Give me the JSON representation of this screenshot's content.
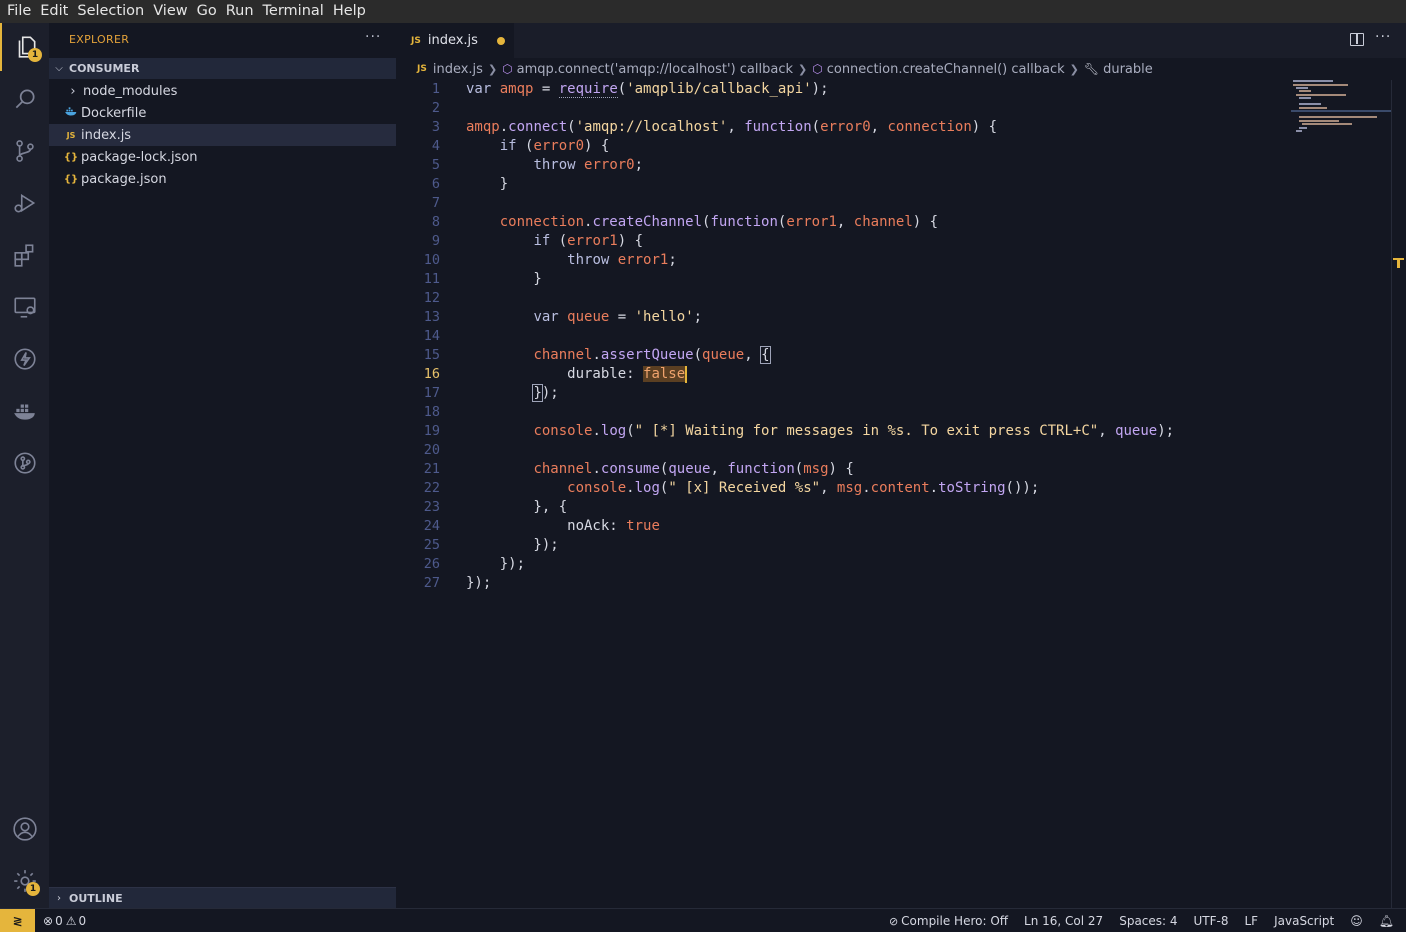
{
  "menu": [
    "File",
    "Edit",
    "Selection",
    "View",
    "Go",
    "Run",
    "Terminal",
    "Help"
  ],
  "activity": {
    "explorer_badge": "1",
    "settings_badge": "1"
  },
  "sidebar": {
    "title": "EXPLORER",
    "more": "···",
    "section": "CONSUMER",
    "items": [
      {
        "label": "node_modules",
        "icon": "chevron-right-icon"
      },
      {
        "label": "Dockerfile",
        "icon": "docker-icon"
      },
      {
        "label": "index.js",
        "icon": "js-icon"
      },
      {
        "label": "package-lock.json",
        "icon": "json-icon"
      },
      {
        "label": "package.json",
        "icon": "json-icon"
      }
    ],
    "outline": "OUTLINE"
  },
  "tab": {
    "js_tag": "JS",
    "name": "index.js"
  },
  "breadcrumb": {
    "js_tag": "JS",
    "file": "index.js",
    "crumb1": "amqp.connect('amqp://localhost') callback",
    "crumb2": "connection.createChannel() callback",
    "crumb3": "durable"
  },
  "editor": {
    "active_line": 16,
    "line_numbers": [
      "1",
      "2",
      "3",
      "4",
      "5",
      "6",
      "7",
      "8",
      "9",
      "10",
      "11",
      "12",
      "13",
      "14",
      "15",
      "16",
      "17",
      "18",
      "19",
      "20",
      "21",
      "22",
      "23",
      "24",
      "25",
      "26",
      "27"
    ]
  },
  "status": {
    "remote_icon": "remote-icon",
    "errors": "0",
    "warnings": "0",
    "compile_hero": "Compile Hero: Off",
    "position": "Ln 16, Col 27",
    "spaces": "Spaces: 4",
    "encoding": "UTF-8",
    "eol": "LF",
    "language": "JavaScript"
  },
  "colors": {
    "accent": "#e5b53c",
    "background": "#141722",
    "keyword": "#b9bee0",
    "variable": "#ea7d5c",
    "function": "#c2a6f2",
    "string": "#f4d6a0"
  }
}
